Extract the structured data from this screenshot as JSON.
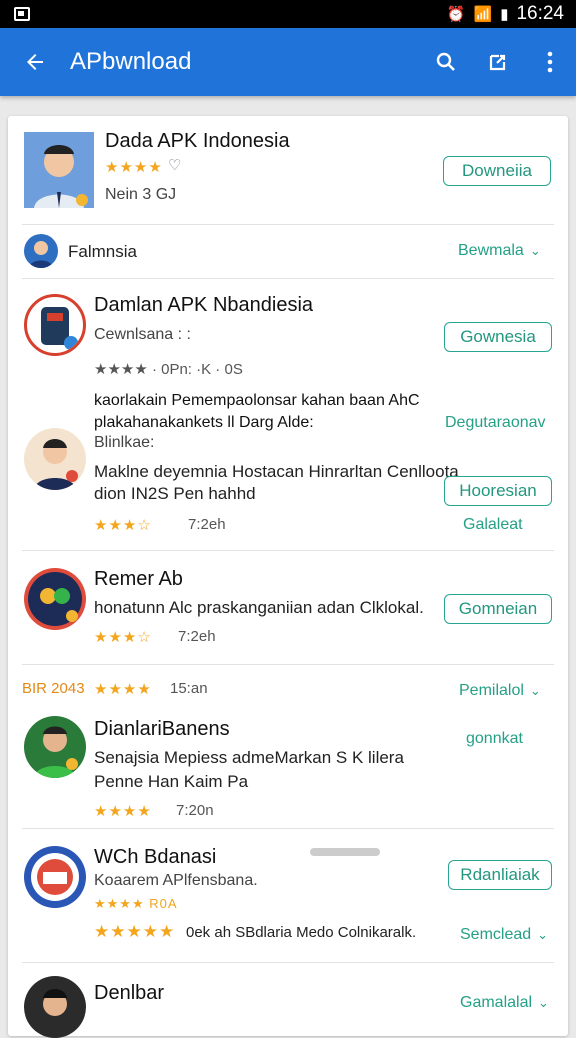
{
  "status": {
    "time": "16:24"
  },
  "appbar": {
    "title": "APbwnload"
  },
  "apps": [
    {
      "title": "Dada APK Indonesia",
      "stars": "★★★★",
      "sub": "Nein 3 GJ",
      "button": "Downeiia"
    },
    {
      "category": "Falmnsia",
      "more": "Bewmala"
    },
    {
      "title": "Damlan APK Nbandiesia",
      "sub": "Cewnlsana : :",
      "meta": "★★★★ · 0Pn: ·K · 0S",
      "button": "Gownesia"
    },
    {
      "title_a": "kaorlakain Pemempaolonsar kahan baan AhC",
      "title_b": "plakahanakankets ll Darg Alde:",
      "sub": "Blinlkae:",
      "desc_a": "Maklne deyemnia Hostacan Hinrarltan Cenlloota",
      "desc_b": "dion IN2S Pen hahhd",
      "meta": "7:2eh",
      "side_link": "Degutaraonav",
      "button": "Hooresian",
      "side_link2": "Galaleat"
    },
    {
      "title": "Remer Ab",
      "desc": "honatunn Alc praskanganiian adan Clklokal.",
      "meta": "7:2eh",
      "button": "Gomneian"
    },
    {
      "category": "BIR 2043",
      "meta": "15:an",
      "more": "Pemilalol"
    },
    {
      "title": "DianlariBanens",
      "desc_a": "Senajsia Mepiess admeMarkan S K lilera",
      "desc_b": "Penne Han Kaim Pa",
      "meta": "7:20n",
      "button": "gonnkat"
    },
    {
      "title": "WCh Bdanasi",
      "sub": "Koaarem APlfensbana.",
      "stars_small": "★★★★ R0A",
      "meta": "0ek ah SBdlaria Medo Colnikaralk.",
      "button": "Rdanliaiak",
      "more": "Semclead"
    },
    {
      "title": "Denlbar",
      "more": "Gamalalal"
    }
  ],
  "icons": [
    "back-arrow",
    "search",
    "share",
    "more-vert"
  ]
}
